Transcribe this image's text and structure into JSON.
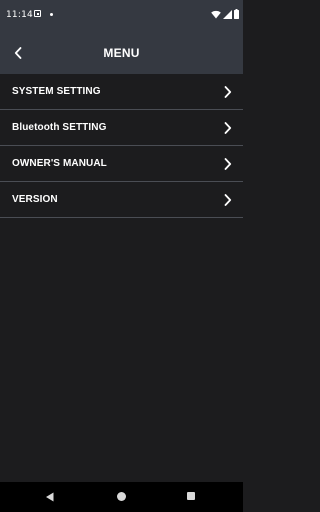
{
  "status_bar": {
    "time": "11:14"
  },
  "app_bar": {
    "title": "MENU",
    "back_icon": "chevron-left-icon"
  },
  "menu": {
    "items": [
      {
        "label": "SYSTEM SETTING"
      },
      {
        "label": "Bluetooth SETTING"
      },
      {
        "label": "OWNER'S MANUAL"
      },
      {
        "label": "VERSION"
      }
    ]
  },
  "nav_bar": {
    "back_icon": "triangle-back-icon",
    "home_icon": "circle-home-icon",
    "recents_icon": "square-recents-icon"
  },
  "colors": {
    "header_bg": "#353941",
    "page_bg": "#1c1c1e",
    "divider": "#4a4d54",
    "text": "#ffffff"
  }
}
